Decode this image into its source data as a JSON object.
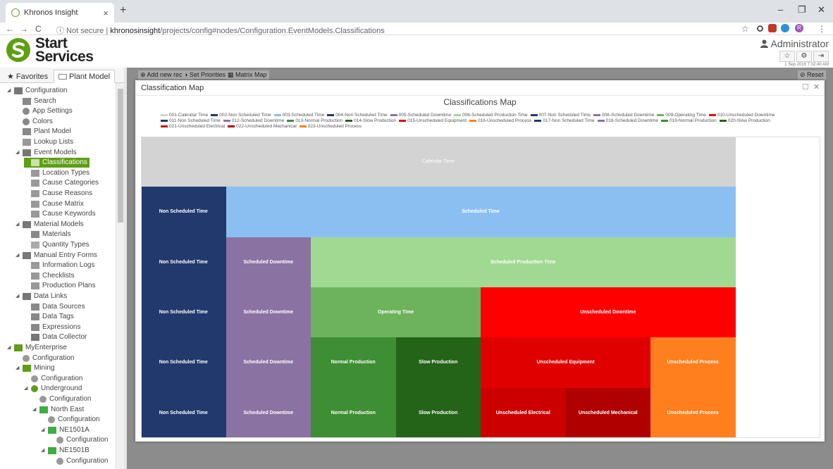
{
  "browser": {
    "tab_title": "Khronos Insight",
    "tab_close": "×",
    "new_tab": "+",
    "minimize": "–",
    "restore": "❐",
    "close": "✕",
    "back": "←",
    "forward": "→",
    "reload": "C",
    "security": "ⓘ Not secure",
    "separator": "|",
    "url_host": "khronosinsight",
    "url_path": "/projects/config#nodes/Configuration.EventModels.Classifications",
    "star": "☆",
    "profile_initial": "R",
    "menu": "⋮"
  },
  "header": {
    "logo_line1": "Start",
    "logo_line2": "Services",
    "user_name": "Administrator",
    "datetime": "1 Sep 2019 7:32:40 AM",
    "fav_btn": "☆",
    "settings_btn": "⚙",
    "logout_btn": "⇥"
  },
  "left_tabs": {
    "favorites": "★ Favorites",
    "plant_model": "Plant Model"
  },
  "tree": [
    {
      "label": "Configuration",
      "indent": 0,
      "expander": "◢",
      "icon": "folder-icon",
      "color": "#777777"
    },
    {
      "label": "Search",
      "indent": 1,
      "expander": "",
      "icon": "search-icon",
      "color": "#888888"
    },
    {
      "label": "App Settings",
      "indent": 1,
      "expander": "",
      "icon": "settings-icon",
      "color": "#888888"
    },
    {
      "label": "Colors",
      "indent": 1,
      "expander": "",
      "icon": "palette-icon",
      "color": "#888888"
    },
    {
      "label": "Plant Model",
      "indent": 1,
      "expander": "",
      "icon": "plant-model-icon",
      "color": "#888888"
    },
    {
      "label": "Lookup Lists",
      "indent": 1,
      "expander": "",
      "icon": "edit-icon",
      "color": "#999999"
    },
    {
      "label": "Event Models",
      "indent": 1,
      "expander": "◢",
      "icon": "folder-icon",
      "color": "#777777"
    },
    {
      "label": "Classifications",
      "indent": 2,
      "expander": "",
      "icon": "list-icon",
      "color": "#cde0b0",
      "selected": true
    },
    {
      "label": "Location Types",
      "indent": 2,
      "expander": "",
      "icon": "edit-icon",
      "color": "#999999"
    },
    {
      "label": "Cause Categories",
      "indent": 2,
      "expander": "",
      "icon": "edit-icon",
      "color": "#999999"
    },
    {
      "label": "Cause Reasons",
      "indent": 2,
      "expander": "",
      "icon": "edit-icon",
      "color": "#999999"
    },
    {
      "label": "Cause Matrix",
      "indent": 2,
      "expander": "",
      "icon": "edit-icon",
      "color": "#999999"
    },
    {
      "label": "Cause Keywords",
      "indent": 2,
      "expander": "",
      "icon": "edit-icon",
      "color": "#999999"
    },
    {
      "label": "Material Models",
      "indent": 1,
      "expander": "◢",
      "icon": "folder-icon",
      "color": "#777777"
    },
    {
      "label": "Materials",
      "indent": 2,
      "expander": "",
      "icon": "drop-icon",
      "color": "#888888"
    },
    {
      "label": "Quantity Types",
      "indent": 2,
      "expander": "",
      "icon": "quantity-icon",
      "color": "#aaaaaa"
    },
    {
      "label": "Manual Entry Forms",
      "indent": 1,
      "expander": "◢",
      "icon": "folder-icon",
      "color": "#777777"
    },
    {
      "label": "Information Logs",
      "indent": 2,
      "expander": "",
      "icon": "form-icon",
      "color": "#999999"
    },
    {
      "label": "Checklists",
      "indent": 2,
      "expander": "",
      "icon": "form-icon",
      "color": "#999999"
    },
    {
      "label": "Production Plans",
      "indent": 2,
      "expander": "",
      "icon": "form-icon",
      "color": "#999999"
    },
    {
      "label": "Data Links",
      "indent": 1,
      "expander": "◢",
      "icon": "folder-icon",
      "color": "#777777"
    },
    {
      "label": "Data Sources",
      "indent": 2,
      "expander": "",
      "icon": "server-icon",
      "color": "#888888"
    },
    {
      "label": "Data Tags",
      "indent": 2,
      "expander": "",
      "icon": "tag-icon",
      "color": "#888888"
    },
    {
      "label": "Expressions",
      "indent": 2,
      "expander": "",
      "icon": "tag-icon",
      "color": "#888888"
    },
    {
      "label": "Data Collector",
      "indent": 2,
      "expander": "",
      "icon": "database-icon",
      "color": "#777777"
    },
    {
      "label": "MyEnterprise",
      "indent": 0,
      "expander": "◢",
      "icon": "enterprise-icon",
      "color": "#5e9e13"
    },
    {
      "label": "Configuration",
      "indent": 1,
      "expander": "",
      "icon": "gear-icon",
      "color": "#999999"
    },
    {
      "label": "Mining",
      "indent": 1,
      "expander": "◢",
      "icon": "mining-icon",
      "color": "#5e9e13"
    },
    {
      "label": "Configuration",
      "indent": 2,
      "expander": "",
      "icon": "gear-icon",
      "color": "#999999"
    },
    {
      "label": "Underground",
      "indent": 2,
      "expander": "◢",
      "icon": "underground-icon",
      "color": "#5e9e13"
    },
    {
      "label": "Configuration",
      "indent": 3,
      "expander": "",
      "icon": "gear-icon",
      "color": "#999999"
    },
    {
      "label": "North East",
      "indent": 3,
      "expander": "◢",
      "icon": "area-icon",
      "color": "#3fae3f"
    },
    {
      "label": "Configuration",
      "indent": 4,
      "expander": "",
      "icon": "gear-icon",
      "color": "#999999"
    },
    {
      "label": "NE1501A",
      "indent": 4,
      "expander": "◢",
      "icon": "area-icon",
      "color": "#3fae3f"
    },
    {
      "label": "Configuration",
      "indent": 5,
      "expander": "",
      "icon": "gear-icon",
      "color": "#999999"
    },
    {
      "label": "NE1501B",
      "indent": 4,
      "expander": "◢",
      "icon": "area-icon",
      "color": "#3fae3f"
    },
    {
      "label": "Configuration",
      "indent": 5,
      "expander": "",
      "icon": "gear-icon",
      "color": "#999999"
    }
  ],
  "toolbar": {
    "add_new": "⊕ Add new record",
    "set_priorities": "◑ Set Priorities",
    "matrix_map": "▦ Matrix Map",
    "reset": "⊘ Reset"
  },
  "modal": {
    "title": "Classification Map",
    "maximize": "☐",
    "close": "✕"
  },
  "chart_data": {
    "type": "treemap",
    "title": "Classifications Map",
    "legend": [
      {
        "label": "001-Calendar Time",
        "color": "#d3d3d3"
      },
      {
        "label": "002-Non Scheduled Time",
        "color": "#22396e"
      },
      {
        "label": "003-Scheduled Time",
        "color": "#8bbff2"
      },
      {
        "label": "004-Non Scheduled Time",
        "color": "#22396e"
      },
      {
        "label": "005-Scheduled Downtime",
        "color": "#8a72a3"
      },
      {
        "label": "006-Scheduled Production Time",
        "color": "#a0d991"
      },
      {
        "label": "007-Non Scheduled Time",
        "color": "#22396e"
      },
      {
        "label": "008-Scheduled Downtime",
        "color": "#8a72a3"
      },
      {
        "label": "009-Operating Time",
        "color": "#6cb35c"
      },
      {
        "label": "010-Unscheduled Downtime",
        "color": "#ff0000"
      },
      {
        "label": "011-Non Scheduled Time",
        "color": "#22396e"
      },
      {
        "label": "012-Scheduled Downtime",
        "color": "#8a72a3"
      },
      {
        "label": "013-Normal Production",
        "color": "#3e8e33"
      },
      {
        "label": "014-Slow Production",
        "color": "#246418"
      },
      {
        "label": "015-Unscheduled Equipment",
        "color": "#e00000"
      },
      {
        "label": "016-Unscheduled Process",
        "color": "#ff7f1e"
      },
      {
        "label": "017-Non Scheduled Time",
        "color": "#22396e"
      },
      {
        "label": "018-Scheduled Downtime",
        "color": "#8a72a3"
      },
      {
        "label": "019-Normal Production",
        "color": "#3e8e33"
      },
      {
        "label": "020-Slow Production",
        "color": "#246418"
      },
      {
        "label": "021-Unscheduled Electrical",
        "color": "#cc0000"
      },
      {
        "label": "022-Unscheduled Mechanical",
        "color": "#b00000"
      },
      {
        "label": "023-Unscheduled Process",
        "color": "#ff7f1e"
      }
    ],
    "rows": [
      {
        "cells": [
          {
            "label": "Calendar Time",
            "span": 7,
            "color": "#d3d3d3",
            "light": true
          },
          {
            "label": "",
            "span": 1,
            "color": "#ffffff"
          }
        ]
      },
      {
        "cells": [
          {
            "label": "Non Scheduled Time",
            "span": 1,
            "color": "#22396e"
          },
          {
            "label": "Scheduled Time",
            "span": 6,
            "color": "#8bbff2"
          },
          {
            "label": "",
            "span": 1,
            "color": "#ffffff"
          }
        ]
      },
      {
        "cells": [
          {
            "label": "Non Scheduled Time",
            "span": 1,
            "color": "#22396e"
          },
          {
            "label": "Scheduled Downtime",
            "span": 1,
            "color": "#8a72a3"
          },
          {
            "label": "Scheduled Production Time",
            "span": 5,
            "color": "#a0d991"
          },
          {
            "label": "",
            "span": 1,
            "color": "#ffffff"
          }
        ]
      },
      {
        "cells": [
          {
            "label": "Non Scheduled Time",
            "span": 1,
            "color": "#22396e"
          },
          {
            "label": "Scheduled Downtime",
            "span": 1,
            "color": "#8a72a3"
          },
          {
            "label": "Operating Time",
            "span": 2,
            "color": "#6cb35c"
          },
          {
            "label": "Unscheduled Downtime",
            "span": 3,
            "color": "#ff0000"
          },
          {
            "label": "",
            "span": 1,
            "color": "#ffffff"
          }
        ]
      },
      {
        "cells": [
          {
            "label": "Non Scheduled Time",
            "span": 1,
            "color": "#22396e"
          },
          {
            "label": "Scheduled Downtime",
            "span": 1,
            "color": "#8a72a3"
          },
          {
            "label": "Normal Production",
            "span": 1,
            "color": "#3e8e33"
          },
          {
            "label": "Slow Production",
            "span": 1,
            "color": "#246418"
          },
          {
            "label": "Unscheduled Equipment",
            "span": 2,
            "color": "#e00000"
          },
          {
            "label": "Unscheduled Process",
            "span": 1,
            "color": "#ff7f1e"
          },
          {
            "label": "",
            "span": 1,
            "color": "#ffffff"
          }
        ]
      },
      {
        "cells": [
          {
            "label": "Non Scheduled Time",
            "span": 1,
            "color": "#22396e"
          },
          {
            "label": "Scheduled Downtime",
            "span": 1,
            "color": "#8a72a3"
          },
          {
            "label": "Normal Production",
            "span": 1,
            "color": "#3e8e33"
          },
          {
            "label": "Slow Production",
            "span": 1,
            "color": "#246418"
          },
          {
            "label": "Unscheduled Electrical",
            "span": 1,
            "color": "#cc0000"
          },
          {
            "label": "Unscheduled Mechanical",
            "span": 1,
            "color": "#b00000"
          },
          {
            "label": "Unscheduled Process",
            "span": 1,
            "color": "#ff7f1e"
          },
          {
            "label": "",
            "span": 1,
            "color": "#ffffff"
          }
        ]
      }
    ]
  }
}
